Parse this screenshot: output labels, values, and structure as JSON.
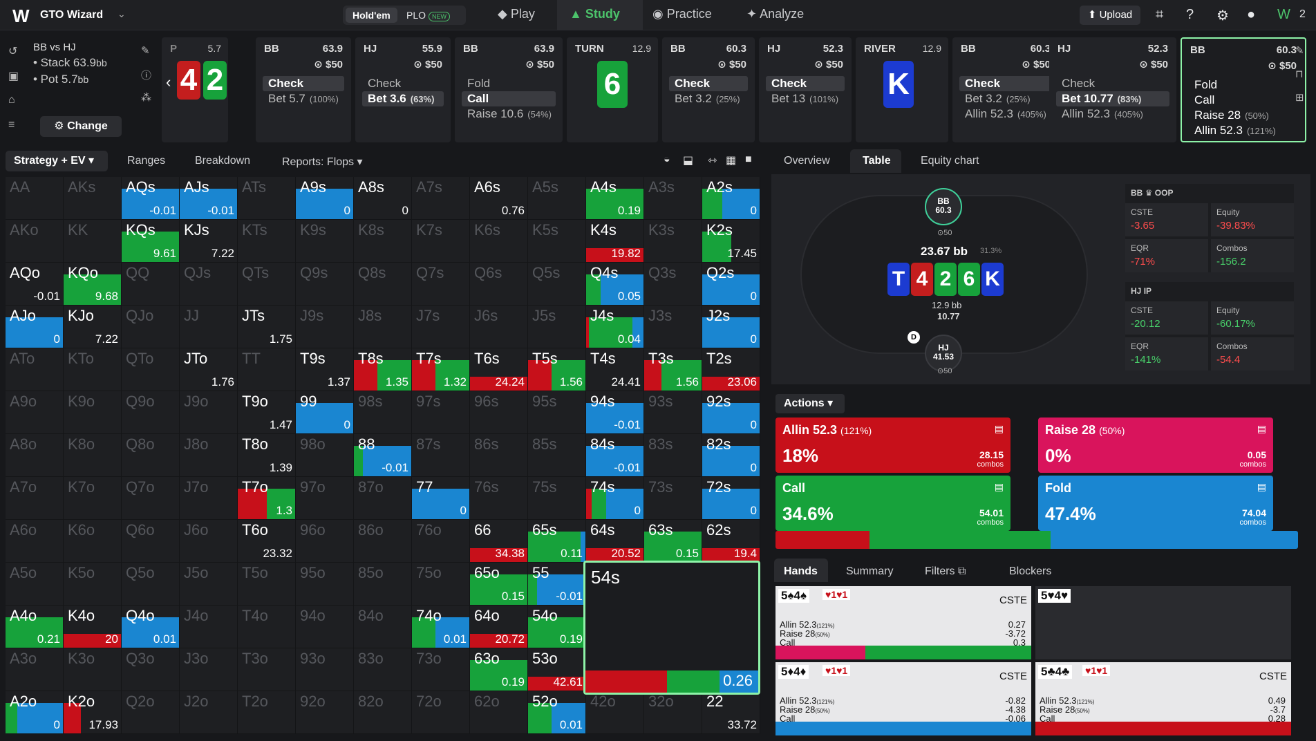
{
  "nav": {
    "title": "GTO Wizard",
    "game_holdem": "Hold'em",
    "game_plo": "PLO",
    "badge_new": "NEW",
    "items": [
      "Play",
      "Study",
      "Practice",
      "Analyze"
    ],
    "upload": "Upload",
    "avatar_badge": "2"
  },
  "summary": {
    "header": "BB vs HJ",
    "stack_label": "• Stack 63.9",
    "stack_unit": "bb",
    "pot_label": "• Pot 5.7",
    "pot_unit": "bb",
    "change": "Change"
  },
  "preflop": {
    "label": "P",
    "pot": "5.7",
    "cards": [
      "4",
      "2"
    ]
  },
  "columns": [
    {
      "pos": "BB",
      "stack": "63.9",
      "pot": "$50",
      "actions": [
        [
          "Check",
          ""
        ],
        [
          "Bet 5.7",
          "(100%)"
        ]
      ],
      "selected": 0
    },
    {
      "pos": "HJ",
      "stack": "55.9",
      "pot": "$50",
      "actions": [
        [
          "Check",
          ""
        ],
        [
          "Bet 3.6",
          "(63%)"
        ]
      ],
      "selected": 1
    },
    {
      "pos": "BB",
      "stack": "63.9",
      "pot": "$50",
      "actions": [
        [
          "Fold",
          ""
        ],
        [
          "Call",
          ""
        ],
        [
          "Raise 10.6",
          "(54%)"
        ]
      ],
      "selected": 1
    },
    {
      "pos": "BB",
      "stack": "60.3",
      "pot": "$50",
      "actions": [
        [
          "Check",
          ""
        ],
        [
          "Bet 3.2",
          "(25%)"
        ]
      ],
      "selected": 0
    },
    {
      "pos": "HJ",
      "stack": "52.3",
      "pot": "$50",
      "actions": [
        [
          "Check",
          ""
        ],
        [
          "Bet 13",
          "(101%)"
        ]
      ],
      "selected": 0
    },
    {
      "pos": "BB",
      "stack": "60.3",
      "pot": "$50",
      "actions": [
        [
          "Check",
          ""
        ],
        [
          "Bet 3.2",
          "(25%)"
        ],
        [
          "Allin 52.3",
          "(405%)"
        ]
      ],
      "selected": 0
    },
    {
      "pos": "HJ",
      "stack": "52.3",
      "pot": "$50",
      "actions": [
        [
          "Check",
          ""
        ],
        [
          "Bet 10.77",
          "(83%)"
        ],
        [
          "Allin 52.3",
          "(405%)"
        ]
      ],
      "selected": 1
    },
    {
      "pos": "BB",
      "stack": "60.3",
      "pot": "$50",
      "actions": [
        [
          "Fold",
          ""
        ],
        [
          "Call",
          ""
        ],
        [
          "Raise 28",
          "(50%)"
        ],
        [
          "Allin 52.3",
          "(121%)"
        ]
      ],
      "selected": -1
    }
  ],
  "streets": [
    {
      "name": "TURN",
      "pot": "12.9",
      "card": "6"
    },
    {
      "name": "RIVER",
      "pot": "12.9",
      "card": "K"
    }
  ],
  "subtabs": {
    "strategy": "Strategy + EV",
    "items": [
      "Ranges",
      "Breakdown",
      "Reports: Flops"
    ],
    "right": [
      "Overview",
      "Table",
      "Equity chart"
    ]
  },
  "grid": [
    [
      "AA",
      "AKs",
      "AQs",
      "AJs",
      "ATs",
      "A9s",
      "A8s",
      "A7s",
      "A6s",
      "A5s",
      "A4s",
      "A3s",
      "A2s"
    ],
    [
      "AKo",
      "KK",
      "KQs",
      "KJs",
      "KTs",
      "K9s",
      "K8s",
      "K7s",
      "K6s",
      "K5s",
      "K4s",
      "K3s",
      "K2s"
    ],
    [
      "AQo",
      "KQo",
      "QQ",
      "QJs",
      "QTs",
      "Q9s",
      "Q8s",
      "Q7s",
      "Q6s",
      "Q5s",
      "Q4s",
      "Q3s",
      "Q2s"
    ],
    [
      "AJo",
      "KJo",
      "QJo",
      "JJ",
      "JTs",
      "J9s",
      "J8s",
      "J7s",
      "J6s",
      "J5s",
      "J4s",
      "J3s",
      "J2s"
    ],
    [
      "ATo",
      "KTo",
      "QTo",
      "JTo",
      "TT",
      "T9s",
      "T8s",
      "T7s",
      "T6s",
      "T5s",
      "T4s",
      "T3s",
      "T2s"
    ],
    [
      "A9o",
      "K9o",
      "Q9o",
      "J9o",
      "T9o",
      "99",
      "98s",
      "97s",
      "96s",
      "95s",
      "94s",
      "93s",
      "92s"
    ],
    [
      "A8o",
      "K8o",
      "Q8o",
      "J8o",
      "T8o",
      "98o",
      "88",
      "87s",
      "86s",
      "85s",
      "84s",
      "83s",
      "82s"
    ],
    [
      "A7o",
      "K7o",
      "Q7o",
      "J7o",
      "T7o",
      "97o",
      "87o",
      "77",
      "76s",
      "75s",
      "74s",
      "73s",
      "72s"
    ],
    [
      "A6o",
      "K6o",
      "Q6o",
      "J6o",
      "T6o",
      "96o",
      "86o",
      "76o",
      "66",
      "65s",
      "64s",
      "63s",
      "62s"
    ],
    [
      "A5o",
      "K5o",
      "Q5o",
      "J5o",
      "T5o",
      "95o",
      "85o",
      "75o",
      "65o",
      "55",
      "54s",
      "53s",
      "52s"
    ],
    [
      "A4o",
      "K4o",
      "Q4o",
      "J4o",
      "T4o",
      "94o",
      "84o",
      "74o",
      "64o",
      "54o",
      "44",
      "43s",
      "42s"
    ],
    [
      "A3o",
      "K3o",
      "Q3o",
      "J3o",
      "T3o",
      "93o",
      "83o",
      "73o",
      "63o",
      "53o",
      "43o",
      "33",
      "32s"
    ],
    [
      "A2o",
      "K2o",
      "Q2o",
      "J2o",
      "T2o",
      "92o",
      "82o",
      "72o",
      "62o",
      "52o",
      "42o",
      "32o",
      "22"
    ]
  ],
  "solved": {
    "AQs": {
      "ev": "-0.01",
      "mix": [
        [
          0,
          0,
          100
        ]
      ]
    },
    "AJs": {
      "ev": "-0.01",
      "mix": [
        [
          0,
          0,
          100
        ]
      ]
    },
    "A9s": {
      "ev": "0",
      "mix": [
        [
          0,
          0,
          100
        ]
      ]
    },
    "A8s": {
      "ev": "0",
      "mix": []
    },
    "A6s": {
      "ev": "0.76",
      "mix": []
    },
    "A4s": {
      "ev": "0.19",
      "mix": [
        [
          0,
          100,
          0
        ]
      ]
    },
    "A2s": {
      "ev": "0",
      "mix": [
        [
          0,
          35,
          65
        ]
      ]
    },
    "KQs": {
      "ev": "9.61",
      "mix": [
        [
          0,
          100,
          0
        ]
      ]
    },
    "KJs": {
      "ev": "7.22",
      "mix": []
    },
    "K4s": {
      "ev": "19.82",
      "mix": [
        [
          100,
          0,
          0
        ]
      ]
    },
    "K2s": {
      "ev": "17.45",
      "mix": [
        [
          0,
          50,
          0
        ]
      ]
    },
    "AQo": {
      "ev": "-0.01",
      "mix": []
    },
    "KQo": {
      "ev": "9.68",
      "mix": [
        [
          0,
          100,
          0
        ]
      ]
    },
    "Q4s": {
      "ev": "0.05",
      "mix": [
        [
          0,
          25,
          75
        ]
      ]
    },
    "Q2s": {
      "ev": "0",
      "mix": [
        [
          0,
          0,
          100
        ]
      ]
    },
    "AJo": {
      "ev": "0",
      "mix": [
        [
          0,
          0,
          100
        ]
      ]
    },
    "KJo": {
      "ev": "7.22",
      "mix": []
    },
    "JTs": {
      "ev": "1.75",
      "mix": []
    },
    "J4s": {
      "ev": "0.04",
      "mix": [
        [
          5,
          75,
          20
        ]
      ]
    },
    "J2s": {
      "ev": "0",
      "mix": [
        [
          0,
          0,
          100
        ]
      ]
    },
    "JTo": {
      "ev": "1.76",
      "mix": []
    },
    "T9s": {
      "ev": "1.37",
      "mix": []
    },
    "T8s": {
      "ev": "1.35",
      "mix": [
        [
          40,
          60,
          0
        ]
      ]
    },
    "T7s": {
      "ev": "1.32",
      "mix": [
        [
          40,
          60,
          0
        ]
      ]
    },
    "T6s": {
      "ev": "24.24",
      "mix": [
        [
          100,
          0,
          0
        ]
      ]
    },
    "T5s": {
      "ev": "1.56",
      "mix": [
        [
          40,
          60,
          0
        ]
      ]
    },
    "T4s": {
      "ev": "24.41",
      "mix": []
    },
    "T3s": {
      "ev": "1.56",
      "mix": [
        [
          30,
          70,
          0
        ]
      ]
    },
    "T2s": {
      "ev": "23.06",
      "mix": [
        [
          100,
          0,
          0
        ]
      ]
    },
    "T9o": {
      "ev": "1.47",
      "mix": []
    },
    "99": {
      "ev": "0",
      "mix": [
        [
          0,
          0,
          100
        ]
      ]
    },
    "94s": {
      "ev": "-0.01",
      "mix": [
        [
          0,
          0,
          100
        ]
      ]
    },
    "92s": {
      "ev": "0",
      "mix": [
        [
          0,
          0,
          100
        ]
      ]
    },
    "T8o": {
      "ev": "1.39",
      "mix": []
    },
    "88": {
      "ev": "-0.01",
      "mix": [
        [
          0,
          15,
          85
        ]
      ]
    },
    "84s": {
      "ev": "-0.01",
      "mix": [
        [
          0,
          0,
          100
        ]
      ]
    },
    "82s": {
      "ev": "0",
      "mix": [
        [
          0,
          0,
          100
        ]
      ]
    },
    "T7o": {
      "ev": "1.3",
      "mix": [
        [
          50,
          50,
          0
        ]
      ]
    },
    "77": {
      "ev": "0",
      "mix": [
        [
          0,
          0,
          100
        ]
      ]
    },
    "74s": {
      "ev": "0",
      "mix": [
        [
          10,
          25,
          65
        ]
      ]
    },
    "72s": {
      "ev": "0",
      "mix": [
        [
          0,
          0,
          100
        ]
      ]
    },
    "T6o": {
      "ev": "23.32",
      "mix": []
    },
    "66": {
      "ev": "34.38",
      "mix": [
        [
          100,
          0,
          0
        ]
      ]
    },
    "65s": {
      "ev": "0.11",
      "mix": [
        [
          0,
          90,
          10
        ]
      ]
    },
    "64s": {
      "ev": "20.52",
      "mix": [
        [
          100,
          0,
          0
        ]
      ]
    },
    "63s": {
      "ev": "0.15",
      "mix": [
        [
          0,
          100,
          0
        ]
      ]
    },
    "62s": {
      "ev": "19.4",
      "mix": [
        [
          100,
          0,
          0
        ]
      ]
    },
    "65o": {
      "ev": "0.15",
      "mix": [
        [
          0,
          100,
          0
        ]
      ]
    },
    "55": {
      "ev": "-0.01",
      "mix": [
        [
          0,
          15,
          85
        ]
      ]
    },
    "A4o": {
      "ev": "0.21",
      "mix": [
        [
          0,
          100,
          0
        ]
      ]
    },
    "K4o": {
      "ev": "20",
      "mix": [
        [
          100,
          0,
          0
        ]
      ]
    },
    "Q4o": {
      "ev": "0.01",
      "mix": [
        [
          0,
          0,
          100
        ]
      ]
    },
    "74o": {
      "ev": "0.01",
      "mix": [
        [
          0,
          40,
          60
        ]
      ]
    },
    "64o": {
      "ev": "20.72",
      "mix": [
        [
          100,
          0,
          0
        ]
      ]
    },
    "54o": {
      "ev": "0.19",
      "mix": [
        [
          0,
          100,
          0
        ]
      ]
    },
    "63o": {
      "ev": "0.19",
      "mix": [
        [
          0,
          100,
          0
        ]
      ]
    },
    "53o": {
      "ev": "42.61",
      "mix": [
        [
          100,
          0,
          0
        ]
      ]
    },
    "A2o": {
      "ev": "0",
      "mix": [
        [
          0,
          20,
          80
        ]
      ]
    },
    "K2o": {
      "ev": "17.93",
      "mix": [
        [
          30,
          0,
          0
        ]
      ]
    },
    "52o": {
      "ev": "0.01",
      "mix": [
        [
          0,
          40,
          60
        ]
      ]
    },
    "22": {
      "ev": "33.72",
      "mix": []
    }
  },
  "selected_cell": {
    "label": "54s",
    "ev": "0.26"
  },
  "table": {
    "bb_seat": {
      "pos": "BB",
      "stack": "60.3",
      "chips": "50"
    },
    "hj_seat": {
      "pos": "HJ",
      "stack": "41.53",
      "chips": "50"
    },
    "pot": "23.67 bb",
    "pot_pct": "31.3%",
    "board": [
      "T",
      "4",
      "2",
      "6",
      "K"
    ],
    "bet_stack": "12.9 bb",
    "bet_amount": "10.77",
    "dealer": "D"
  },
  "stats": {
    "bb": {
      "header": "BB",
      "role": "OOP",
      "cste_k": "CSTE",
      "cste": "-3.65",
      "equity_k": "Equity",
      "equity": "-39.83%",
      "eqr_k": "EQR",
      "eqr": "-71%",
      "combos_k": "Combos",
      "combos": "-156.2"
    },
    "hj": {
      "header": "HJ",
      "role": "IP",
      "cste_k": "CSTE",
      "cste": "-20.12",
      "equity_k": "Equity",
      "equity": "-60.17%",
      "eqr_k": "EQR",
      "eqr": "-141%",
      "combos_k": "Combos",
      "combos": "-54.4"
    }
  },
  "actions": {
    "label": "Actions",
    "items": [
      {
        "name": "Allin 52.3",
        "pct_label": "(121%)",
        "freq": "18%",
        "combos": "28.15",
        "combos_label": "combos",
        "color": "#c7101a"
      },
      {
        "name": "Raise 28",
        "pct_label": "(50%)",
        "freq": "0%",
        "combos": "0.05",
        "combos_label": "combos",
        "color": "#d9145c"
      },
      {
        "name": "Call",
        "pct_label": "",
        "freq": "34.6%",
        "combos": "54.01",
        "combos_label": "combos",
        "color": "#17a23b"
      },
      {
        "name": "Fold",
        "pct_label": "",
        "freq": "47.4%",
        "combos": "74.04",
        "combos_label": "combos",
        "color": "#1a86d1"
      }
    ],
    "freq_bar": [
      18,
      0,
      34.6,
      47.4
    ]
  },
  "handtabs": [
    "Hands",
    "Summary",
    "Filters",
    "Blockers"
  ],
  "hands": [
    {
      "combo": "5♠4♠",
      "blockers": "♥1♥1",
      "cste": "CSTE",
      "lines": [
        [
          "Allin 52.3",
          "(121%)",
          "0.27"
        ],
        [
          "Raise 28",
          "(50%)",
          "-3.72"
        ],
        [
          "Call",
          "",
          "0.3"
        ],
        [
          "Fold",
          "",
          ""
        ]
      ],
      "bar": [
        0,
        35,
        65,
        0
      ]
    },
    {
      "combo": "5♥4♥",
      "blockers": "",
      "cste": "",
      "lines": [],
      "bar": []
    },
    {
      "combo": "5♦4♦",
      "blockers": "♥1♥1",
      "cste": "CSTE",
      "lines": [
        [
          "Allin 52.3",
          "(121%)",
          "-0.82"
        ],
        [
          "Raise 28",
          "(50%)",
          "-4.38"
        ],
        [
          "Call",
          "",
          "-0.06"
        ],
        [
          "Fold",
          "",
          ""
        ]
      ],
      "bar": [
        0,
        0,
        0,
        100
      ]
    },
    {
      "combo": "5♣4♣",
      "blockers": "♥1♥1",
      "cste": "CSTE",
      "lines": [
        [
          "Allin 52.3",
          "(121%)",
          "0.49"
        ],
        [
          "Raise 28",
          "(50%)",
          "-3.7"
        ],
        [
          "Call",
          "",
          "0.28"
        ],
        [
          "Fold",
          "",
          ""
        ]
      ],
      "bar": [
        100,
        0,
        0,
        0
      ]
    }
  ],
  "colors": {
    "allin": "#c7101a",
    "raise": "#d9145c",
    "call": "#17a23b",
    "fold": "#1a86d1",
    "accent": "#4cc36b"
  }
}
